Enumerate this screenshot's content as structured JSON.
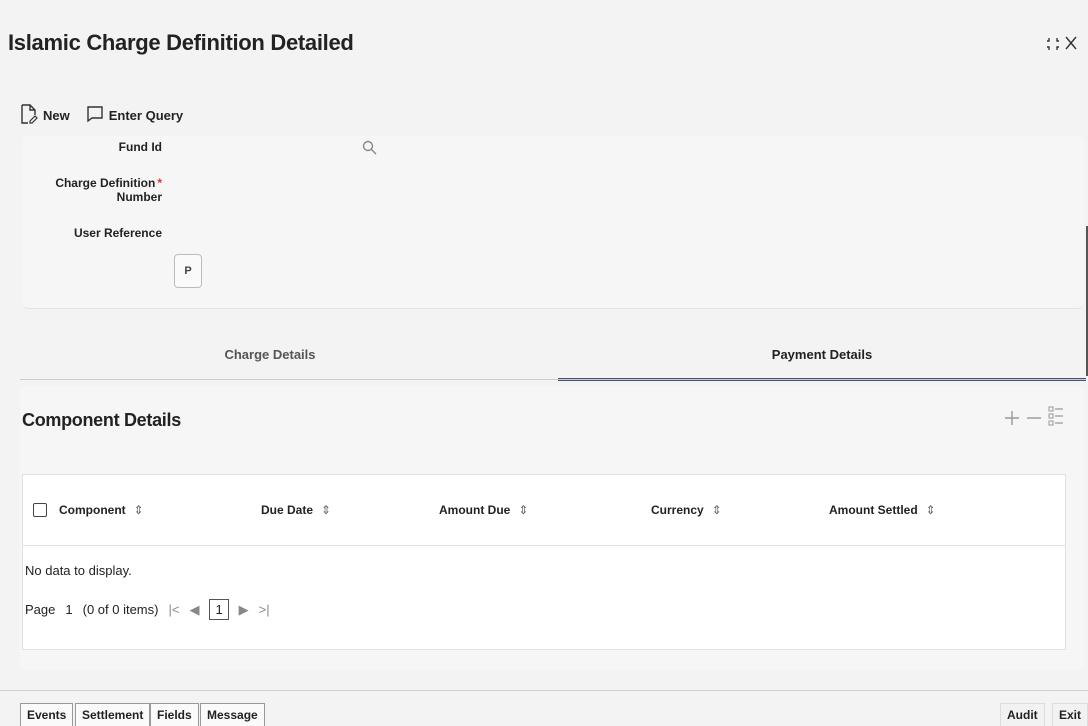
{
  "window": {
    "title": "Islamic Charge Definition Detailed"
  },
  "toolbar": {
    "new_label": "New",
    "enter_query_label": "Enter Query"
  },
  "header": {
    "fund_id_label": "Fund Id",
    "charge_def_label_1": "Charge Definition",
    "charge_def_label_2": "Number",
    "required_mark": "*",
    "user_ref_label": "User Reference",
    "p_button": "P"
  },
  "tabs": {
    "charge_details": "Charge Details",
    "payment_details": "Payment Details"
  },
  "section": {
    "title": "Component Details"
  },
  "grid": {
    "columns": [
      "Component",
      "Due Date",
      "Amount Due",
      "Currency",
      "Amount Settled"
    ],
    "sort_glyph": "⇕",
    "no_data": "No data to display."
  },
  "pager": {
    "page_label": "Page",
    "page_number": "1",
    "items_info": "(0 of 0 items)",
    "current": "1"
  },
  "footer": {
    "events": "Events",
    "settlement": "Settlement",
    "fields": "Fields",
    "message": "Message",
    "audit": "Audit",
    "exit": "Exit"
  }
}
